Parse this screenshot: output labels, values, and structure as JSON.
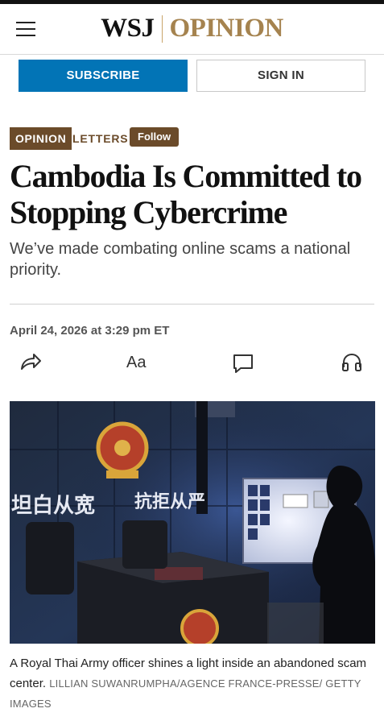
{
  "header": {
    "logo_left": "WSJ",
    "logo_right": "OPINION",
    "icons": {
      "menu": "hamburger-menu-icon"
    }
  },
  "auth": {
    "subscribe_label": "SUBSCRIBE",
    "signin_label": "SIGN IN"
  },
  "article": {
    "section_tag": "OPINION",
    "subsection": "LETTERS",
    "follow_label": "Follow",
    "headline": "Cambodia Is Committed to Stopping Cybercrime",
    "dek": "We’ve made combating online scams a national priority.",
    "timestamp": "April 24, 2026 at 3:29 pm ET",
    "text_size_label": "Aa"
  },
  "tools": {
    "icons": [
      "share-icon",
      "text-size-icon",
      "comment-icon",
      "headphones-icon"
    ]
  },
  "photo": {
    "wall_text_left": "坦白从宽",
    "wall_text_right": "抗拒从严",
    "caption": "A Royal Thai Army officer shines a light inside an abandoned scam center.",
    "credit": "LILLIAN SUWANRUMPHA/AGENCE FRANCE-PRESSE/ GETTY IMAGES"
  },
  "colors": {
    "accent_blue": "#0274b6",
    "opinion_brown": "#6b4b2a",
    "logo_gold": "#a5834f"
  }
}
